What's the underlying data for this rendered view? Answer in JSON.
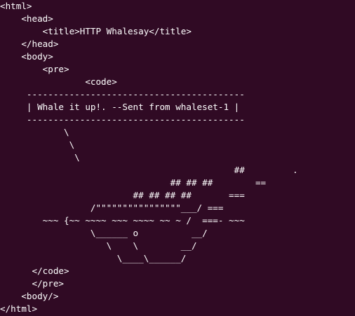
{
  "terminal": {
    "background": "#300a24",
    "foreground": "#ffffff",
    "lines": [
      "<html>",
      "    <head>",
      "        <title>HTTP Whalesay</title>",
      "    </head>",
      "    <body>",
      "        <pre>",
      "                <code>",
      "     -----------------------------------------",
      "     | Whale it up!. --Sent from whaleset-1 |",
      "     -----------------------------------------",
      "            \\",
      "             \\",
      "              \\",
      "                                            ##         .",
      "                                ## ## ##        ==",
      "                         ## ## ## ##       ===",
      "                 /\"\"\"\"\"\"\"\"\"\"\"\"\"\"\"\"___/ ===",
      "        ~~~ {~~ ~~~~ ~~~ ~~~~ ~~ ~ /  ===- ~~~",
      "                 \\______ o          __/",
      "                    \\    \\        __/",
      "                      \\____\\______/",
      "      </code>",
      "      </pre>",
      "    <body/>",
      "</html>"
    ]
  }
}
